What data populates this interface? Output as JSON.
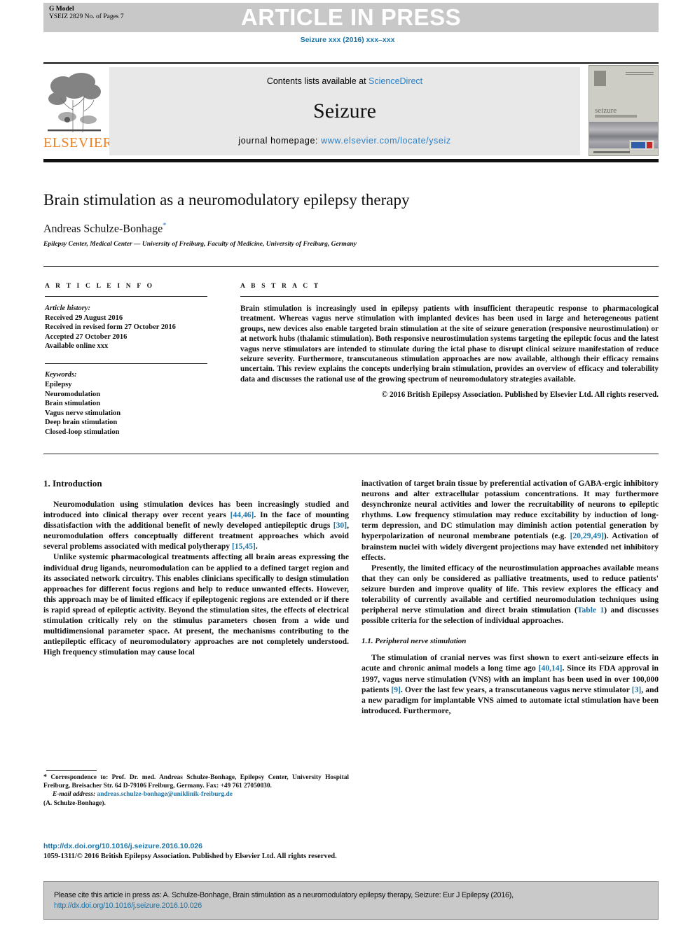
{
  "banner": {
    "g_model": "G Model",
    "model_id": "YSEIZ 2829 No. of Pages 7",
    "article_in_press": "ARTICLE IN PRESS"
  },
  "journal_ref": "Seizure xxx (2016) xxx–xxx",
  "masthead": {
    "publisher": "ELSEVIER",
    "contents_prefix": "Contents lists available at ",
    "contents_link": "ScienceDirect",
    "journal_title": "Seizure",
    "homepage_label": "journal homepage: ",
    "homepage_url": "www.elsevier.com/locate/yseiz",
    "cover_journal_name": "seizure"
  },
  "article": {
    "title": "Brain stimulation as a neuromodulatory epilepsy therapy",
    "authors": "Andreas Schulze-Bonhage",
    "author_marker": "*",
    "affiliation": "Epilepsy Center, Medical Center — University of Freiburg, Faculty of Medicine, University of Freiburg, Germany"
  },
  "article_info": {
    "heading": "A R T I C L E   I N F O",
    "history_label": "Article history:",
    "history": [
      "Received 29 August 2016",
      "Received in revised form 27 October 2016",
      "Accepted 27 October 2016",
      "Available online xxx"
    ],
    "keywords_label": "Keywords:",
    "keywords": [
      "Epilepsy",
      "Neuromodulation",
      "Brain stimulation",
      "Vagus nerve stimulation",
      "Deep brain stimulation",
      "Closed-loop stimulation"
    ]
  },
  "abstract": {
    "heading": "A B S T R A C T",
    "text": "Brain stimulation is increasingly used in epilepsy patients with insufficient therapeutic response to pharmacological treatment. Whereas vagus nerve stimulation with implanted devices has been used in large and heterogeneous patient groups, new devices also enable targeted brain stimulation at the site of seizure generation (responsive neurostimulation) or at network hubs (thalamic stimulation). Both responsive neurostimulation systems targeting the epileptic focus and the latest vagus nerve stimulators are intended to stimulate during the ictal phase to disrupt clinical seizure manifestation of reduce seizure severity. Furthermore, transcutaneous stimulation approaches are now available, although their efficacy remains uncertain. This review explains the concepts underlying brain stimulation, provides an overview of efficacy and tolerability data and discusses the rational use of the growing spectrum of neuromodulatory strategies available.",
    "copyright": "© 2016 British Epilepsy Association. Published by Elsevier Ltd. All rights reserved."
  },
  "body": {
    "section1_heading": "1. Introduction",
    "left_paragraphs": [
      {
        "parts": [
          {
            "t": "Neuromodulation using stimulation devices has been increasingly studied and introduced into clinical therapy over recent years ",
            "ref": false
          },
          {
            "t": "[44,46]",
            "ref": true
          },
          {
            "t": ". In the face of mounting dissatisfaction with the additional benefit of newly developed antiepileptic drugs ",
            "ref": false
          },
          {
            "t": "[30]",
            "ref": true
          },
          {
            "t": ", neuromodulation offers conceptually different treatment approaches which avoid several problems associated with medical polytherapy ",
            "ref": false
          },
          {
            "t": "[15,45]",
            "ref": true
          },
          {
            "t": ".",
            "ref": false
          }
        ]
      },
      {
        "parts": [
          {
            "t": "Unlike systemic pharmacological treatments affecting all brain areas expressing the individual drug ligands, neuromodulation can be applied to a defined target region and its associated network circuitry. This enables clinicians specifically to design stimulation approaches for different focus regions and help to reduce unwanted effects. However, this approach may be of limited efficacy if epileptogenic regions are extended or if there is rapid spread of epileptic activity. Beyond the stimulation sites, the effects of electrical stimulation critically rely on the stimulus parameters chosen from a wide und multidimensional parameter space. At present, the mechanisms contributing to the antiepileptic efficacy of neuromodulatory approaches are not completely understood. High frequency stimulation may cause local",
            "ref": false
          }
        ]
      }
    ],
    "right_paragraphs": [
      {
        "noindent": true,
        "parts": [
          {
            "t": "inactivation of target brain tissue by preferential activation of GABA-ergic inhibitory neurons and alter extracellular potassium concentrations. It may furthermore desynchronize neural activities and lower the recruitability of neurons to epileptic rhythms. Low frequency stimulation may reduce excitability by induction of long-term depression, and DC stimulation may diminish action potential generation by hyperpolarization of neuronal membrane potentials (e.g. ",
            "ref": false
          },
          {
            "t": "[20,29,49]",
            "ref": true
          },
          {
            "t": "). Activation of brainstem nuclei with widely divergent projections may have extended net inhibitory effects.",
            "ref": false
          }
        ]
      },
      {
        "parts": [
          {
            "t": "Presently, the limited efficacy of the neurostimulation approaches available means that they can only be considered as palliative treatments, used to reduce patients' seizure burden and improve quality of life. This review explores the efficacy and tolerability of currently available and certified neuromodulation techniques using peripheral nerve stimulation and direct brain stimulation (",
            "ref": false
          },
          {
            "t": "Table 1",
            "ref": true
          },
          {
            "t": ") and discusses possible criteria for the selection of individual approaches.",
            "ref": false
          }
        ]
      }
    ],
    "subsection_heading": "1.1. Peripheral nerve stimulation",
    "right_paragraphs2": [
      {
        "parts": [
          {
            "t": "The stimulation of cranial nerves was first shown to exert anti-seizure effects in acute and chronic animal models a long time ago ",
            "ref": false
          },
          {
            "t": "[40,14]",
            "ref": true
          },
          {
            "t": ". Since its FDA approval in 1997, vagus nerve stimulation (VNS) with an implant has been used in over 100,000 patients ",
            "ref": false
          },
          {
            "t": "[9]",
            "ref": true
          },
          {
            "t": ". Over the last few years, a transcutaneous vagus nerve stimulator ",
            "ref": false
          },
          {
            "t": "[3]",
            "ref": true
          },
          {
            "t": ", and a new paradigm for implantable VNS aimed to automate ictal stimulation have been introduced. Furthermore,",
            "ref": false
          }
        ]
      }
    ]
  },
  "footnote": {
    "marker": "*",
    "correspondence": " Correspondence to: Prof. Dr. med. Andreas Schulze-Bonhage, Epilepsy Center, University Hospital Freiburg, Breisacher Str. 64 D-79106 Freiburg, Germany. Fax: +49 761 27050030.",
    "email_label": "E-mail address: ",
    "email": "andreas.schulze-bonhage@uniklinik-freiburg.de",
    "email_owner": "(A. Schulze-Bonhage)."
  },
  "footer": {
    "doi": "http://dx.doi.org/10.1016/j.seizure.2016.10.026",
    "issn_copyright": "1059-1311/© 2016 British Epilepsy Association. Published by Elsevier Ltd. All rights reserved."
  },
  "cite_box": {
    "text": "Please cite this article in press as: A. Schulze-Bonhage, Brain stimulation as a neuromodulatory epilepsy therapy, Seizure: Eur J Epilepsy (2016),",
    "url": "http://dx.doi.org/10.1016/j.seizure.2016.10.026"
  },
  "colors": {
    "link": "#1b74a8",
    "banner_grey": "#c8c8c8",
    "elsevier_orange": "#f08221"
  }
}
